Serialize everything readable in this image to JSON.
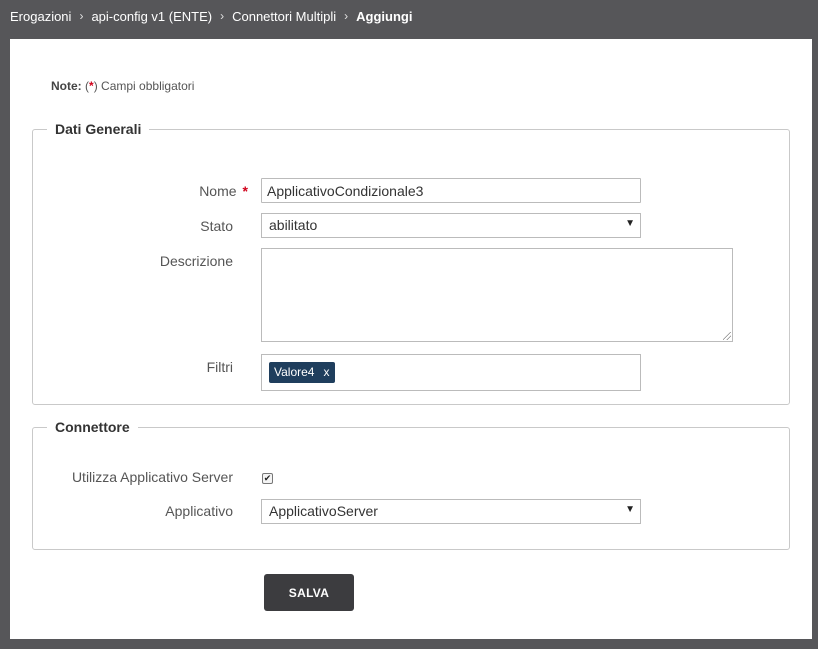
{
  "breadcrumb": [
    {
      "label": "Erogazioni"
    },
    {
      "label": "api-config v1 (ENTE)"
    },
    {
      "label": "Connettori Multipli"
    },
    {
      "label": "Aggiungi"
    }
  ],
  "note": {
    "prefix": "Note:",
    "open": "(",
    "star": "*",
    "close": ")",
    "text": "Campi obbligatori"
  },
  "dati_generali": {
    "legend": "Dati Generali",
    "nome": {
      "label": "Nome",
      "required_mark": "*",
      "value": "ApplicativoCondizionale3"
    },
    "stato": {
      "label": "Stato",
      "value": "abilitato"
    },
    "descrizione": {
      "label": "Descrizione",
      "value": ""
    },
    "filtri": {
      "label": "Filtri",
      "tags": [
        {
          "label": "Valore4",
          "remove": "x"
        }
      ]
    }
  },
  "connettore": {
    "legend": "Connettore",
    "utilizza": {
      "label": "Utilizza Applicativo Server",
      "checked": true,
      "mark": "✔"
    },
    "applicativo": {
      "label": "Applicativo",
      "value": "ApplicativoServer"
    }
  },
  "actions": {
    "save_label": "SALVA"
  },
  "colors": {
    "background": "#565659",
    "tag": "#1f3e5d",
    "button": "#3c3c3f",
    "required": "#d0021b"
  }
}
